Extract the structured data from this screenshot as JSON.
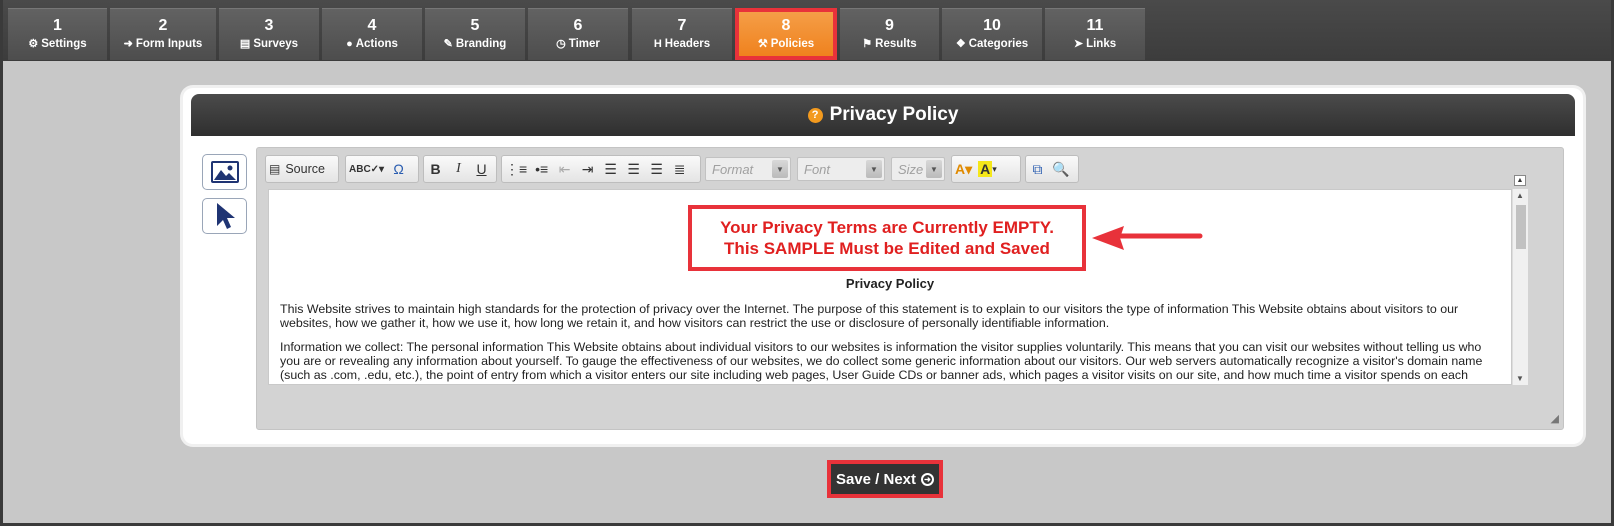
{
  "tabs": [
    {
      "num": "1",
      "label": "Settings",
      "icon": "gear-icon",
      "glyph": "⚙"
    },
    {
      "num": "2",
      "label": "Form Inputs",
      "icon": "sign-in-icon",
      "glyph": "➜"
    },
    {
      "num": "3",
      "label": "Surveys",
      "icon": "table-icon",
      "glyph": "▤"
    },
    {
      "num": "4",
      "label": "Actions",
      "icon": "user-icon",
      "glyph": "●"
    },
    {
      "num": "5",
      "label": "Branding",
      "icon": "brush-icon",
      "glyph": "✎"
    },
    {
      "num": "6",
      "label": "Timer",
      "icon": "clock-icon",
      "glyph": "◷"
    },
    {
      "num": "7",
      "label": "Headers",
      "icon": "header-icon",
      "glyph": "H"
    },
    {
      "num": "8",
      "label": "Policies",
      "icon": "gavel-icon",
      "glyph": "⚒"
    },
    {
      "num": "9",
      "label": "Results",
      "icon": "flag-icon",
      "glyph": "⚑"
    },
    {
      "num": "10",
      "label": "Categories",
      "icon": "cubes-icon",
      "glyph": "❖"
    },
    {
      "num": "11",
      "label": "Links",
      "icon": "pointer-icon",
      "glyph": "➤"
    }
  ],
  "active_tab": "8",
  "panel": {
    "title": "Privacy Policy",
    "help_glyph": "?"
  },
  "toolbar": {
    "source_label": "Source",
    "format_placeholder": "Format",
    "font_placeholder": "Font",
    "size_placeholder": "Size"
  },
  "editor": {
    "notice_line1": "Your Privacy Terms are Currently EMPTY.",
    "notice_line2": "This SAMPLE Must be Edited and Saved",
    "doc_title": "Privacy Policy",
    "para1": "This Website strives to maintain high standards for the protection of privacy over the Internet. The purpose of this statement is to explain to our visitors the type of information This Website obtains about visitors to our websites, how we gather it, how we use it, how long we retain it, and how visitors can restrict the use or disclosure of personally identifiable information.",
    "para2": "Information we collect: The personal information This Website obtains about individual visitors to our websites is information the visitor supplies voluntarily. This means that you can visit our websites without telling us who you are or revealing any information about yourself. To gauge the effectiveness of our websites, we do collect some generic information about our visitors. Our web servers automatically recognize a visitor's domain name (such as .com, .edu, etc.), the point of entry from which a visitor enters our site including web pages, User Guide CDs or banner ads, which pages a visitor visits on our site, and how much time a visitor spends on each page. This information is not linked to any personally identifiable information about the visitor."
  },
  "save_button": {
    "label": "Save / Next"
  },
  "colors": {
    "accent": "#ef7f1a",
    "highlight": "#e8323a",
    "header": "#333333"
  }
}
